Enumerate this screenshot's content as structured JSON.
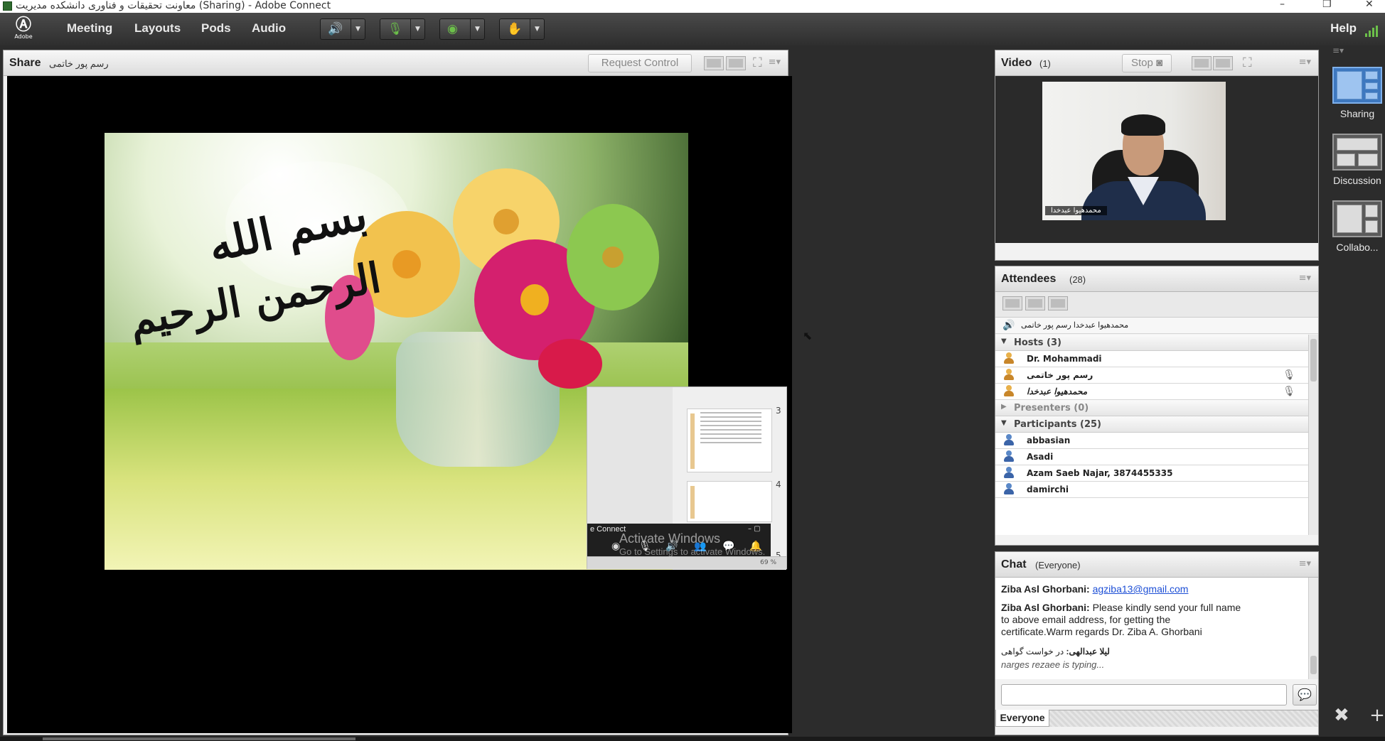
{
  "window": {
    "title": "معاونت تحقیقات و فناوری دانشکده مدیریت (Sharing) - Adobe Connect",
    "controls": [
      "–",
      "❐",
      "✕"
    ]
  },
  "menubar": {
    "logo_text": "Adobe",
    "items": [
      "Meeting",
      "Layouts",
      "Pods",
      "Audio"
    ],
    "help": "Help",
    "toolbar_icons": [
      "speaker-icon",
      "microphone-icon",
      "webcam-icon",
      "raise-hand-icon"
    ]
  },
  "share_pod": {
    "title": "Share",
    "presenter": "رسم پور خاتمی",
    "request_control": "Request Control"
  },
  "slide": {
    "calligraphy_line1": "بسم الله",
    "calligraphy_line2": "الرحمن الرحيم"
  },
  "mini_window": {
    "app_label": "e Connect",
    "watermark_title": "Activate Windows",
    "watermark_sub": "Go to Settings to activate Windows.",
    "thumb_numbers": [
      "3",
      "4",
      "5"
    ],
    "zoom": "69 %"
  },
  "video_pod": {
    "title": "Video",
    "count": "(1)",
    "stop_label": "Stop",
    "name_tag": "محمدهیوا عبدخدا"
  },
  "attendees_pod": {
    "title": "Attendees",
    "count": "(28)",
    "speaking": "محمدهیوا عبدخدا رسم پور خاتمی",
    "hosts_label": "Hosts (3)",
    "hosts": [
      "Dr. Mohammadi",
      "رسم پور خاتمی",
      "محمدهیوا عبدخدا"
    ],
    "presenters_label": "Presenters (0)",
    "participants_label": "Participants (25)",
    "participants": [
      "abbasian",
      "Asadi",
      "Azam Saeb Najar, 3874455335",
      "damirchi"
    ]
  },
  "chat_pod": {
    "title": "Chat",
    "scope": "(Everyone)",
    "messages": [
      {
        "sender": "Ziba Asl Ghorbani:",
        "text": "",
        "link": "agziba13@gmail.com"
      },
      {
        "sender": "Ziba Asl Ghorbani:",
        "text": "Please kindly send your full name to above email address, for getting the certificate.Warm regards Dr. Ziba A. Ghorbani",
        "link": ""
      },
      {
        "sender": "لیلا عبدالهی:",
        "text": "در خواست گواهی",
        "link": ""
      }
    ],
    "typing": "narges rezaee is typing...",
    "input_value": "",
    "tab": "Everyone"
  },
  "layouts_bar": {
    "items": [
      "Sharing",
      "Discussion",
      "Collabo..."
    ],
    "active": "Sharing"
  },
  "colors": {
    "accent": "#3e78bf",
    "mic_green": "#6cc04a",
    "menubar": "#3a3a3a"
  }
}
